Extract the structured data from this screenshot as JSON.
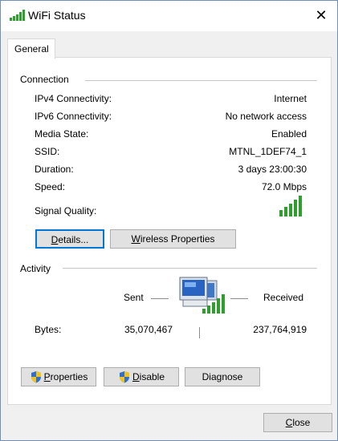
{
  "window": {
    "title": "WiFi Status",
    "close_glyph": "✕"
  },
  "tabs": [
    {
      "label": "General",
      "selected": true
    }
  ],
  "connection": {
    "heading": "Connection",
    "rows": [
      {
        "label": "IPv4 Connectivity:",
        "value": "Internet"
      },
      {
        "label": "IPv6 Connectivity:",
        "value": "No network access"
      },
      {
        "label": "Media State:",
        "value": "Enabled"
      },
      {
        "label": "SSID:",
        "value": "MTNL_1DEF74_1"
      },
      {
        "label": "Duration:",
        "value": "3 days 23:00:30"
      },
      {
        "label": "Speed:",
        "value": "72.0 Mbps"
      }
    ],
    "signal_quality_label": "Signal Quality:",
    "signal_bars_lit": 5,
    "signal_bars_total": 5,
    "details_pre": "",
    "details_ul": "D",
    "details_post": "etails...",
    "wireless_pre": "",
    "wireless_ul": "W",
    "wireless_post": "ireless Properties"
  },
  "activity": {
    "heading": "Activity",
    "sent_label": "Sent",
    "received_label": "Received",
    "bytes_label": "Bytes:",
    "bytes_sent": "35,070,467",
    "bytes_received": "237,764,919"
  },
  "actions": {
    "properties_ul": "P",
    "properties_post": "roperties",
    "disable_ul": "D",
    "disable_post": "isable",
    "diagnose_label": "Diagnose"
  },
  "footer": {
    "close_ul": "C",
    "close_post": "lose"
  },
  "colors": {
    "accent": "#0078d7",
    "signal_green": "#2f9e2f"
  },
  "icons": [
    "wifi-signal-icon",
    "network-computers-icon",
    "uac-shield-icon",
    "close-icon"
  ]
}
